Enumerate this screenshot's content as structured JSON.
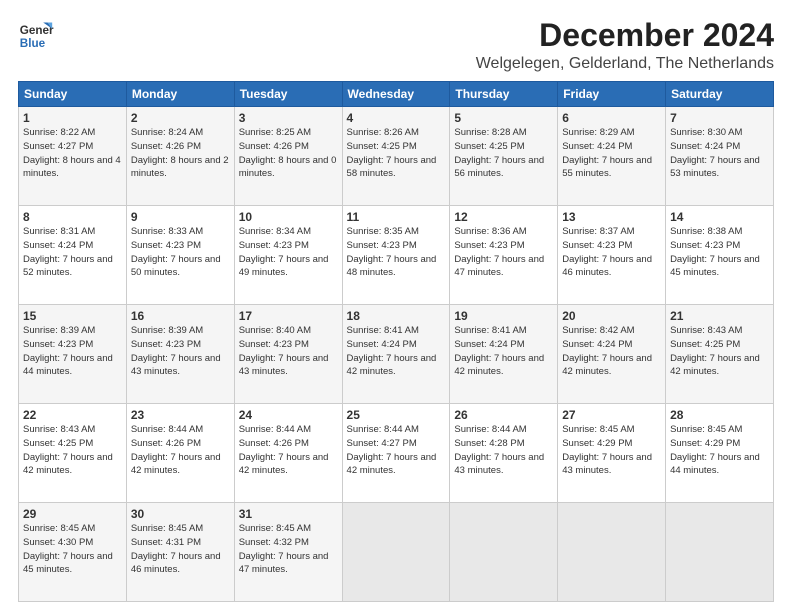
{
  "logo": {
    "line1": "General",
    "line2": "Blue"
  },
  "title": "December 2024",
  "subtitle": "Welgelegen, Gelderland, The Netherlands",
  "headers": [
    "Sunday",
    "Monday",
    "Tuesday",
    "Wednesday",
    "Thursday",
    "Friday",
    "Saturday"
  ],
  "weeks": [
    [
      {
        "day": 1,
        "sunrise": "8:22 AM",
        "sunset": "4:27 PM",
        "daylight": "8 hours and 4 minutes"
      },
      {
        "day": 2,
        "sunrise": "8:24 AM",
        "sunset": "4:26 PM",
        "daylight": "8 hours and 2 minutes"
      },
      {
        "day": 3,
        "sunrise": "8:25 AM",
        "sunset": "4:26 PM",
        "daylight": "8 hours and 0 minutes"
      },
      {
        "day": 4,
        "sunrise": "8:26 AM",
        "sunset": "4:25 PM",
        "daylight": "7 hours and 58 minutes"
      },
      {
        "day": 5,
        "sunrise": "8:28 AM",
        "sunset": "4:25 PM",
        "daylight": "7 hours and 56 minutes"
      },
      {
        "day": 6,
        "sunrise": "8:29 AM",
        "sunset": "4:24 PM",
        "daylight": "7 hours and 55 minutes"
      },
      {
        "day": 7,
        "sunrise": "8:30 AM",
        "sunset": "4:24 PM",
        "daylight": "7 hours and 53 minutes"
      }
    ],
    [
      {
        "day": 8,
        "sunrise": "8:31 AM",
        "sunset": "4:24 PM",
        "daylight": "7 hours and 52 minutes"
      },
      {
        "day": 9,
        "sunrise": "8:33 AM",
        "sunset": "4:23 PM",
        "daylight": "7 hours and 50 minutes"
      },
      {
        "day": 10,
        "sunrise": "8:34 AM",
        "sunset": "4:23 PM",
        "daylight": "7 hours and 49 minutes"
      },
      {
        "day": 11,
        "sunrise": "8:35 AM",
        "sunset": "4:23 PM",
        "daylight": "7 hours and 48 minutes"
      },
      {
        "day": 12,
        "sunrise": "8:36 AM",
        "sunset": "4:23 PM",
        "daylight": "7 hours and 47 minutes"
      },
      {
        "day": 13,
        "sunrise": "8:37 AM",
        "sunset": "4:23 PM",
        "daylight": "7 hours and 46 minutes"
      },
      {
        "day": 14,
        "sunrise": "8:38 AM",
        "sunset": "4:23 PM",
        "daylight": "7 hours and 45 minutes"
      }
    ],
    [
      {
        "day": 15,
        "sunrise": "8:39 AM",
        "sunset": "4:23 PM",
        "daylight": "7 hours and 44 minutes"
      },
      {
        "day": 16,
        "sunrise": "8:39 AM",
        "sunset": "4:23 PM",
        "daylight": "7 hours and 43 minutes"
      },
      {
        "day": 17,
        "sunrise": "8:40 AM",
        "sunset": "4:23 PM",
        "daylight": "7 hours and 43 minutes"
      },
      {
        "day": 18,
        "sunrise": "8:41 AM",
        "sunset": "4:24 PM",
        "daylight": "7 hours and 42 minutes"
      },
      {
        "day": 19,
        "sunrise": "8:41 AM",
        "sunset": "4:24 PM",
        "daylight": "7 hours and 42 minutes"
      },
      {
        "day": 20,
        "sunrise": "8:42 AM",
        "sunset": "4:24 PM",
        "daylight": "7 hours and 42 minutes"
      },
      {
        "day": 21,
        "sunrise": "8:43 AM",
        "sunset": "4:25 PM",
        "daylight": "7 hours and 42 minutes"
      }
    ],
    [
      {
        "day": 22,
        "sunrise": "8:43 AM",
        "sunset": "4:25 PM",
        "daylight": "7 hours and 42 minutes"
      },
      {
        "day": 23,
        "sunrise": "8:44 AM",
        "sunset": "4:26 PM",
        "daylight": "7 hours and 42 minutes"
      },
      {
        "day": 24,
        "sunrise": "8:44 AM",
        "sunset": "4:26 PM",
        "daylight": "7 hours and 42 minutes"
      },
      {
        "day": 25,
        "sunrise": "8:44 AM",
        "sunset": "4:27 PM",
        "daylight": "7 hours and 42 minutes"
      },
      {
        "day": 26,
        "sunrise": "8:44 AM",
        "sunset": "4:28 PM",
        "daylight": "7 hours and 43 minutes"
      },
      {
        "day": 27,
        "sunrise": "8:45 AM",
        "sunset": "4:29 PM",
        "daylight": "7 hours and 43 minutes"
      },
      {
        "day": 28,
        "sunrise": "8:45 AM",
        "sunset": "4:29 PM",
        "daylight": "7 hours and 44 minutes"
      }
    ],
    [
      {
        "day": 29,
        "sunrise": "8:45 AM",
        "sunset": "4:30 PM",
        "daylight": "7 hours and 45 minutes"
      },
      {
        "day": 30,
        "sunrise": "8:45 AM",
        "sunset": "4:31 PM",
        "daylight": "7 hours and 46 minutes"
      },
      {
        "day": 31,
        "sunrise": "8:45 AM",
        "sunset": "4:32 PM",
        "daylight": "7 hours and 47 minutes"
      },
      null,
      null,
      null,
      null
    ]
  ]
}
